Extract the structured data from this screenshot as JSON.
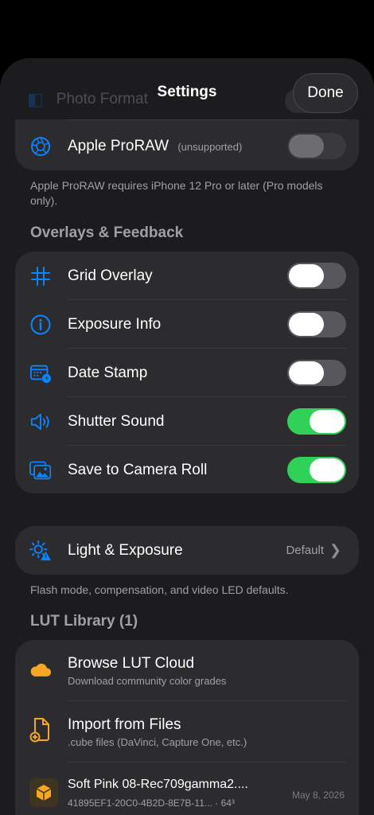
{
  "nav": {
    "title": "Settings",
    "done_label": "Done"
  },
  "ghost_row": {
    "label": "Photo Format"
  },
  "proraw": {
    "label": "Apple ProRAW",
    "badge": "(unsupported)",
    "enabled": false,
    "footnote": "Apple ProRAW requires iPhone 12 Pro or later (Pro models only)."
  },
  "overlays": {
    "header": "Overlays & Feedback",
    "items": [
      {
        "label": "Grid Overlay",
        "icon": "grid-icon",
        "on": false
      },
      {
        "label": "Exposure Info",
        "icon": "info-circle-icon",
        "on": false
      },
      {
        "label": "Date Stamp",
        "icon": "calendar-clock-icon",
        "on": false
      },
      {
        "label": "Shutter Sound",
        "icon": "speaker-icon",
        "on": true
      },
      {
        "label": "Save to Camera Roll",
        "icon": "photos-icon",
        "on": true
      }
    ]
  },
  "light": {
    "label": "Light & Exposure",
    "value": "Default",
    "icon": "sun-warning-icon",
    "footnote": "Flash mode, compensation, and video LED defaults."
  },
  "lut": {
    "header": "LUT Library (1)",
    "browse": {
      "label": "Browse LUT Cloud",
      "sub": "Download community color grades",
      "icon": "cloud-icon"
    },
    "import": {
      "label": "Import from Files",
      "sub": ".cube files (DaVinci, Capture One, etc.)",
      "icon": "doc-add-icon"
    },
    "entries": [
      {
        "name": "Soft Pink 08-Rec709gamma2....",
        "id": "41895EF1-20C0-4B2D-8E7B-11...",
        "size": "64³",
        "date": "May 8, 2026",
        "icon": "cube-icon"
      }
    ]
  },
  "colors": {
    "accent": "#0a84ff",
    "toggle_on": "#30d158",
    "icon_orange": "#f5a623"
  }
}
